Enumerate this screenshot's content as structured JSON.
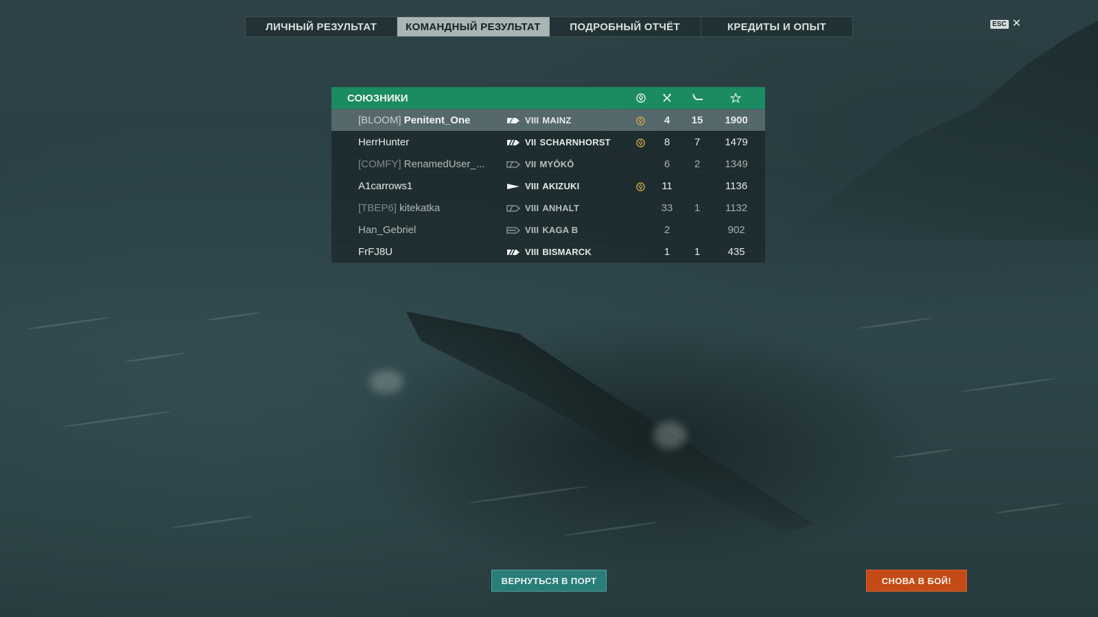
{
  "tabs": [
    {
      "label": "ЛИЧНЫЙ РЕЗУЛЬТАТ",
      "active": false
    },
    {
      "label": "КОМАНДНЫЙ РЕЗУЛЬТАТ",
      "active": true
    },
    {
      "label": "ПОДРОБНЫЙ ОТЧЁТ",
      "active": false
    },
    {
      "label": "КРЕДИТЫ И ОПЫТ",
      "active": false
    }
  ],
  "close": {
    "key_label": "ESC",
    "icon": "close-icon"
  },
  "table": {
    "title": "СОЮЗНИКИ",
    "header_icons": [
      "medal-icon",
      "frags-icon",
      "planes-icon",
      "star-icon"
    ],
    "rows": [
      {
        "clan": "[BLOOM]",
        "player": "Penitent_One",
        "ship_type": "cruiser",
        "tier": "VIII",
        "ship": "MAINZ",
        "medal": true,
        "frags": "4",
        "planes": "15",
        "xp": "1900",
        "highlight": true,
        "dim": false
      },
      {
        "clan": "",
        "player": "HerrHunter",
        "ship_type": "battleship",
        "tier": "VII",
        "ship": "SCHARNHORST",
        "medal": true,
        "frags": "8",
        "planes": "7",
        "xp": "1479",
        "highlight": false,
        "dim": false
      },
      {
        "clan": "[COMFY]",
        "player": "RenamedUser_...",
        "ship_type": "cruiser",
        "tier": "VII",
        "ship": "MYŌKŌ",
        "medal": false,
        "frags": "6",
        "planes": "2",
        "xp": "1349",
        "highlight": false,
        "dim": true
      },
      {
        "clan": "",
        "player": "A1carrows1",
        "ship_type": "destroyer",
        "tier": "VIII",
        "ship": "AKIZUKI",
        "medal": true,
        "frags": "11",
        "planes": "",
        "xp": "1136",
        "highlight": false,
        "dim": false
      },
      {
        "clan": "[TBEP6]",
        "player": "kitekatka",
        "ship_type": "battleship",
        "tier": "VIII",
        "ship": "ANHALT",
        "medal": false,
        "frags": "33",
        "planes": "1",
        "xp": "1132",
        "highlight": false,
        "dim": true
      },
      {
        "clan": "",
        "player": "Han_Gebriel",
        "ship_type": "carrier",
        "tier": "VIII",
        "ship": "KAGA B",
        "medal": false,
        "frags": "2",
        "planes": "",
        "xp": "902",
        "highlight": false,
        "dim": true
      },
      {
        "clan": "",
        "player": "FrFJ8U",
        "ship_type": "battleship",
        "tier": "VIII",
        "ship": "BISMARCK",
        "medal": false,
        "frags": "1",
        "planes": "1",
        "xp": "435",
        "highlight": false,
        "dim": false
      }
    ]
  },
  "buttons": {
    "back_to_port": "ВЕРНУТЬСЯ В ПОРТ",
    "battle_again": "СНОВА В БОЙ!"
  },
  "colors": {
    "header_green": "#1b8b62",
    "accent_orange": "#c44a16",
    "teal_button": "#2a7d78",
    "medal_gold": "#c9a54a"
  }
}
